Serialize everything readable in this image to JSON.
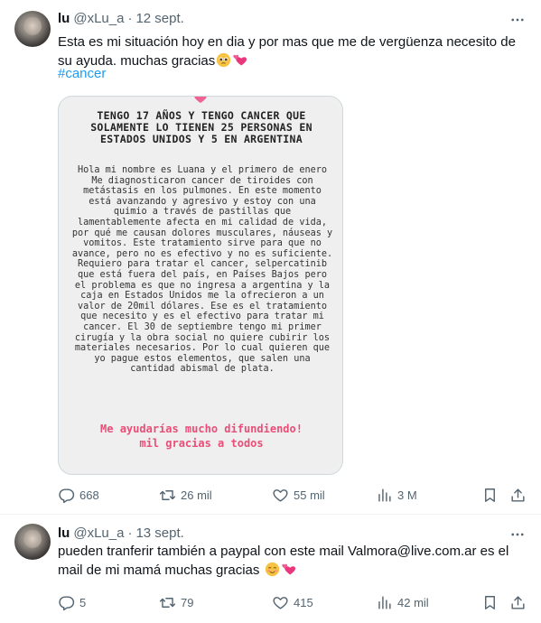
{
  "tweets": [
    {
      "name": "lu",
      "handle": "@xLu_a",
      "dot": "·",
      "date": "12 sept.",
      "text": "Esta es mi situación hoy en dia y por mas que me de vergüenza necesito de su ayuda. muchas gracias",
      "hashtag": "#cancer",
      "media": {
        "title": "TENGO 17 AÑOS Y TENGO CANCER QUE SOLAMENTE LO TIENEN 25 PERSONAS EN ESTADOS UNIDOS Y 5 EN ARGENTINA",
        "body": "Hola mi nombre es Luana y el primero de enero Me diagnosticaron cancer de tiroides con metástasis en los pulmones. En este momento está  avanzando y agresivo y estoy con una quimio a través de pastillas que lamentablemente afecta en mi calidad de vida, por qué me causan dolores musculares, náuseas y vomitos. Este tratamiento sirve para que no avance, pero no es efectivo y no es suficiente. Requiero para tratar el cancer, selpercatinib que está fuera del país, en Países Bajos pero el problema es que no ingresa a argentina y la caja en Estados Unidos me la ofrecieron a un valor de 20mil dólares. Ese es el tratamiento que necesito y es el efectivo para tratar mi cancer. El 30 de septiembre tengo mi primer cirugía y la obra social no quiere cubirir los materiales necesarios. Por lo cual quieren que yo pague estos elementos, que salen una cantidad abismal de plata.",
        "footer": "Me ayudarías mucho difundiendo! mil gracias a todos"
      },
      "replies": "668",
      "retweets": "26 mil",
      "likes": "55 mil",
      "views": "3 M"
    },
    {
      "name": "lu",
      "handle": "@xLu_a",
      "dot": "·",
      "date": "13 sept.",
      "text": "pueden tranferir también a paypal con este mail Valmora@live.com.ar es el mail de mi mamá muchas gracias",
      "replies": "5",
      "retweets": "79",
      "likes": "415",
      "views": "42 mil"
    }
  ],
  "icons": {
    "more": "more-icon",
    "reply": "reply-icon",
    "retweet": "retweet-icon",
    "like": "heart-icon",
    "views": "views-icon",
    "bookmark": "bookmark-icon",
    "share": "share-icon"
  },
  "colors": {
    "text": "#0f1419",
    "secondary": "#536471",
    "link": "#1d9bf0",
    "accent_pink": "#e94e77",
    "border": "#cfd9de"
  }
}
